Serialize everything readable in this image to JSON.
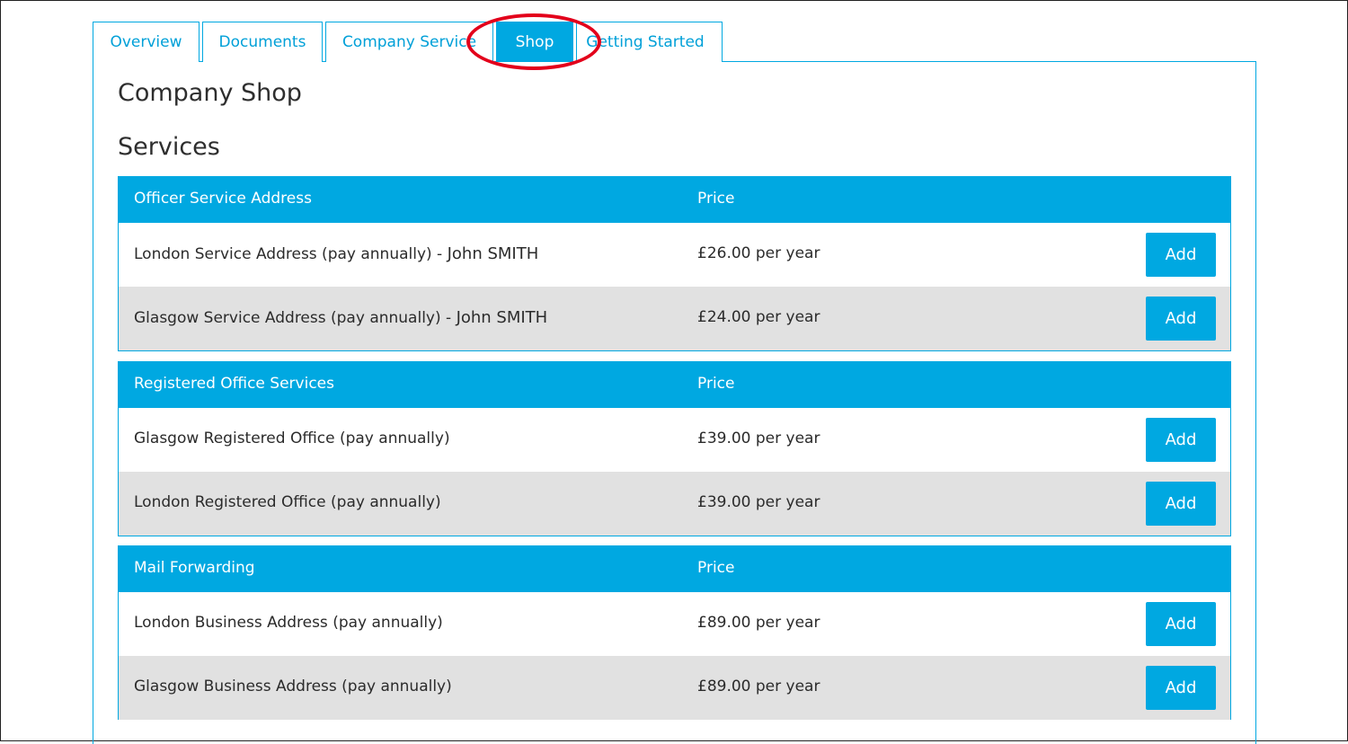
{
  "tabs": [
    {
      "label": "Overview",
      "active": false
    },
    {
      "label": "Documents",
      "active": false
    },
    {
      "label": "Company Service",
      "active": false
    },
    {
      "label": "Shop",
      "active": true
    },
    {
      "label": "Getting Started",
      "active": false
    }
  ],
  "page": {
    "title": "Company Shop",
    "section_title": "Services"
  },
  "groups": [
    {
      "name": "Officer Service Address",
      "price_header": "Price",
      "rows": [
        {
          "name": "London Service Address (pay annually) - ",
          "person": "John SMITH",
          "price": "£26.00 per year",
          "button": "Add"
        },
        {
          "name": "Glasgow Service Address (pay annually) - ",
          "person": "John SMITH",
          "price": "£24.00 per year",
          "button": "Add"
        }
      ]
    },
    {
      "name": "Registered Office Services",
      "price_header": "Price",
      "rows": [
        {
          "name": "Glasgow Registered Office (pay annually)",
          "price": "£39.00 per year",
          "button": "Add"
        },
        {
          "name": "London Registered Office (pay annually)",
          "price": "£39.00 per year",
          "button": "Add"
        }
      ]
    },
    {
      "name": "Mail Forwarding",
      "price_header": "Price",
      "rows": [
        {
          "name": "London Business Address (pay annually)",
          "price": "£89.00 per year",
          "button": "Add"
        },
        {
          "name": "Glasgow Business Address (pay annually)",
          "price": "£89.00 per year",
          "button": "Add"
        }
      ]
    }
  ],
  "colors": {
    "accent": "#00a8e1",
    "highlight_ring": "#e3001b",
    "alt_row": "#e1e1e1"
  }
}
